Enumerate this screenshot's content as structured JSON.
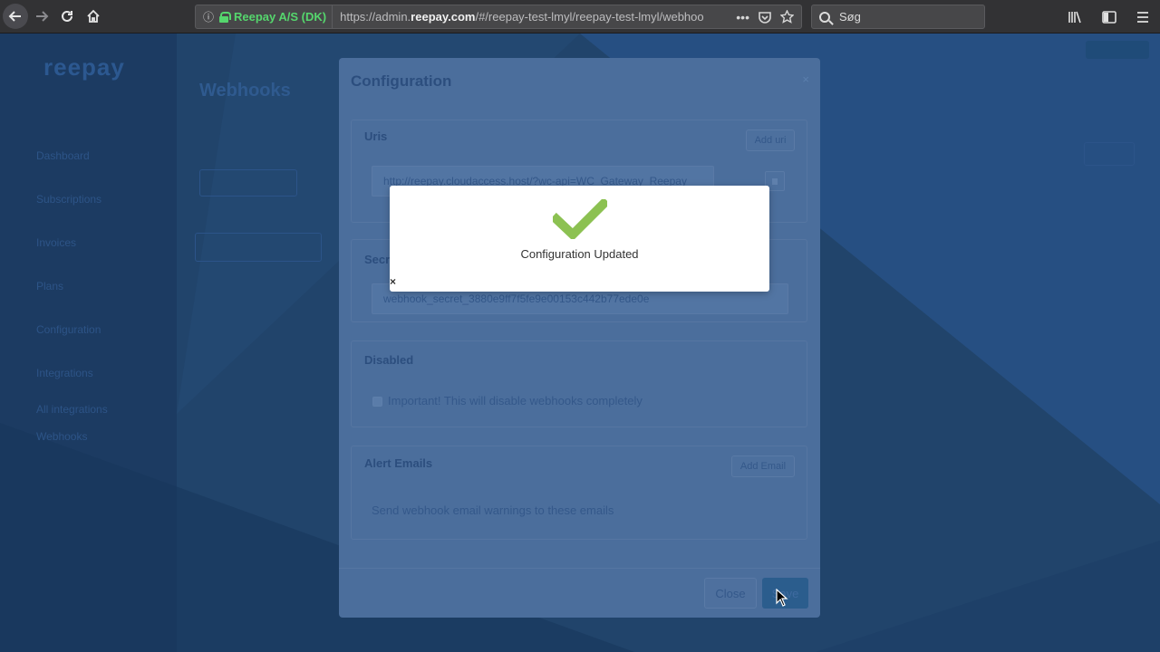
{
  "browser": {
    "identity_org": "Reepay A/S (DK)",
    "url_prefix": "https://admin.",
    "url_domain": "reepay.com",
    "url_path": "/#/reepay-test-lmyl/reepay-test-lmyl/webhooks",
    "search_placeholder": "Søg"
  },
  "app": {
    "logo": "reepay",
    "page_title": "Webhooks",
    "sidebar_items": [
      "Dashboard",
      "Subscriptions",
      "Invoices",
      "Plans",
      "Configuration",
      "Integrations",
      "All integrations",
      "Webhooks"
    ]
  },
  "config_modal": {
    "title": "Configuration",
    "uris": {
      "title": "Uris",
      "add_button": "Add uri",
      "value": "http://reepay.cloudaccess.host/?wc-api=WC_Gateway_Reepay"
    },
    "secret": {
      "title": "Secret",
      "value": "webhook_secret_3880e9ff7f5fe9e00153c442b77ede0e"
    },
    "disabled": {
      "title": "Disabled",
      "checkbox_label": "Important! This will disable webhooks completely"
    },
    "alert_emails": {
      "title": "Alert Emails",
      "add_button": "Add Email",
      "hint": "Send webhook email warnings to these emails"
    },
    "close_button": "Close",
    "save_button": "Save"
  },
  "alert": {
    "message": "Configuration Updated",
    "close_glyph": "×",
    "check_color": "#8cc152"
  }
}
